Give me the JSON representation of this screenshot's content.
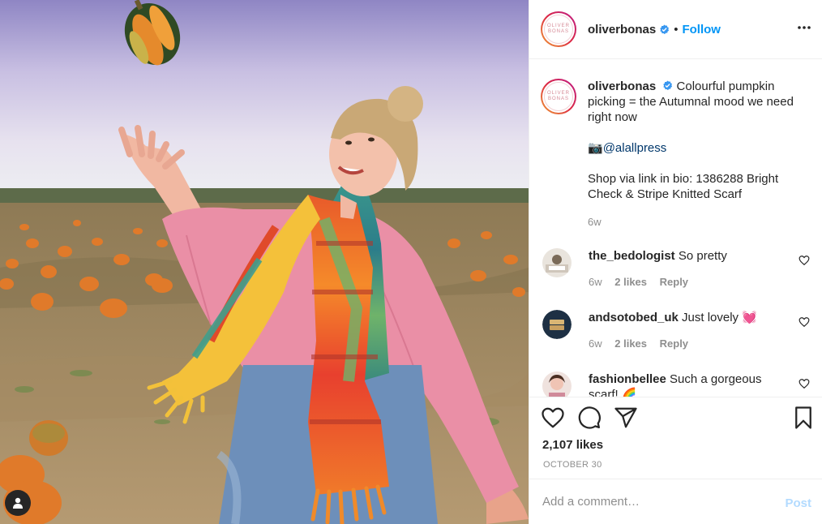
{
  "post": {
    "username": "oliverbonas",
    "follow_label": "Follow",
    "separator": "•",
    "logo_line1": "OLIVER",
    "logo_line2": "BONAS",
    "caption": {
      "text": "Colourful pumpkin picking = the Autumnal mood we need right now",
      "photo_credit_prefix": "📷",
      "photo_credit": "@alallpress",
      "shop_text": "Shop via link in bio: 1386288 Bright Check & Stripe Knitted Scarf",
      "time": "6w"
    },
    "comments": [
      {
        "username": "the_bedologist",
        "text": "So pretty",
        "time": "6w",
        "likes": "2 likes",
        "reply": "Reply"
      },
      {
        "username": "andsotobed_uk",
        "text": "Just lovely 💓",
        "time": "6w",
        "likes": "2 likes",
        "reply": "Reply"
      },
      {
        "username": "fashionbellee",
        "text": "Such a gorgeous scarf! 🌈"
      }
    ],
    "likes_count": "2,107 likes",
    "date": "OCTOBER 30",
    "add_comment_placeholder": "Add a comment…",
    "post_label": "Post"
  },
  "colors": {
    "accent": "#0095f6",
    "post_disabled": "#b3dbff",
    "muted": "#8e8e8e",
    "mention": "#00376b"
  },
  "icons": [
    "user-tag-icon",
    "verified-badge-icon",
    "more-options-icon",
    "heart-icon",
    "comment-icon",
    "share-icon",
    "bookmark-icon"
  ]
}
